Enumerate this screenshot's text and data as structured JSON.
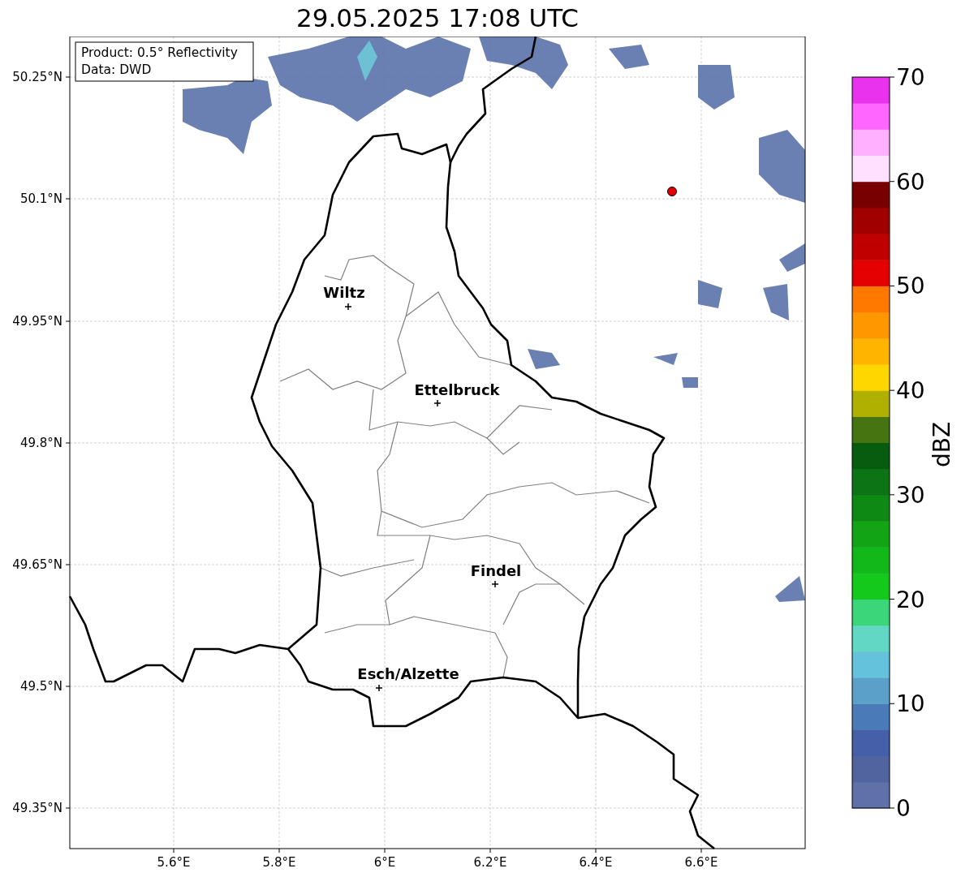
{
  "title": "29.05.2025 17:08 UTC",
  "info_box": [
    "Product: 0.5° Reflectivity",
    "Data: DWD"
  ],
  "y_ticks": [
    "50.25°N",
    "50.1°N",
    "49.95°N",
    "49.8°N",
    "49.65°N",
    "49.5°N",
    "49.35°N"
  ],
  "x_ticks": [
    "5.6°E",
    "5.8°E",
    "6°E",
    "6.2°E",
    "6.4°E",
    "6.6°E"
  ],
  "cities": [
    {
      "name": "Wiltz"
    },
    {
      "name": "Ettelbruck"
    },
    {
      "name": "Findel"
    },
    {
      "name": "Esch/Alzette"
    }
  ],
  "colorbar": {
    "label": "dBZ",
    "ticks": [
      "70",
      "60",
      "50",
      "40",
      "30",
      "20",
      "10",
      "0"
    ]
  }
}
